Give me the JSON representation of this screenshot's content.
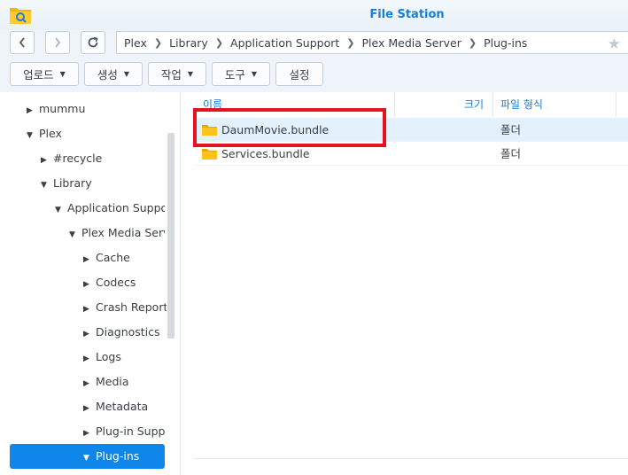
{
  "window": {
    "title": "File Station"
  },
  "nav": {
    "breadcrumb": [
      "Plex",
      "Library",
      "Application Support",
      "Plex Media Server",
      "Plug-ins"
    ],
    "back_icon": "chevron-left-icon",
    "forward_icon": "chevron-right-icon",
    "refresh_icon": "refresh-icon",
    "favorite_icon": "star-icon"
  },
  "toolbar": {
    "upload": "업로드",
    "create": "생성",
    "action": "작업",
    "tools": "도구",
    "settings": "설정"
  },
  "tree": [
    {
      "label": "mummu",
      "expanded": false
    },
    {
      "label": "Plex",
      "expanded": true
    },
    {
      "label": "#recycle",
      "expanded": false
    },
    {
      "label": "Library",
      "expanded": true
    },
    {
      "label": "Application Suppo",
      "expanded": true
    },
    {
      "label": "Plex Media Serv",
      "expanded": true
    },
    {
      "label": "Cache",
      "expanded": false
    },
    {
      "label": "Codecs",
      "expanded": false
    },
    {
      "label": "Crash Report",
      "expanded": false
    },
    {
      "label": "Diagnostics",
      "expanded": false
    },
    {
      "label": "Logs",
      "expanded": false
    },
    {
      "label": "Media",
      "expanded": false
    },
    {
      "label": "Metadata",
      "expanded": false
    },
    {
      "label": "Plug-in Supp",
      "expanded": false
    },
    {
      "label": "Plug-ins",
      "expanded": true,
      "selected": true
    }
  ],
  "filelist": {
    "columns": {
      "name": "이름",
      "size": "크기",
      "type": "파일 형식"
    },
    "rows": [
      {
        "name": "DaumMovie.bundle",
        "size": "",
        "type": "폴더",
        "selected": true,
        "highlighted": true
      },
      {
        "name": "Services.bundle",
        "size": "",
        "type": "폴더",
        "selected": false
      }
    ]
  },
  "colors": {
    "accent": "#0f86e9",
    "title": "#1a7dd8",
    "folder": "#f5b400",
    "highlight": "#e3141f"
  }
}
